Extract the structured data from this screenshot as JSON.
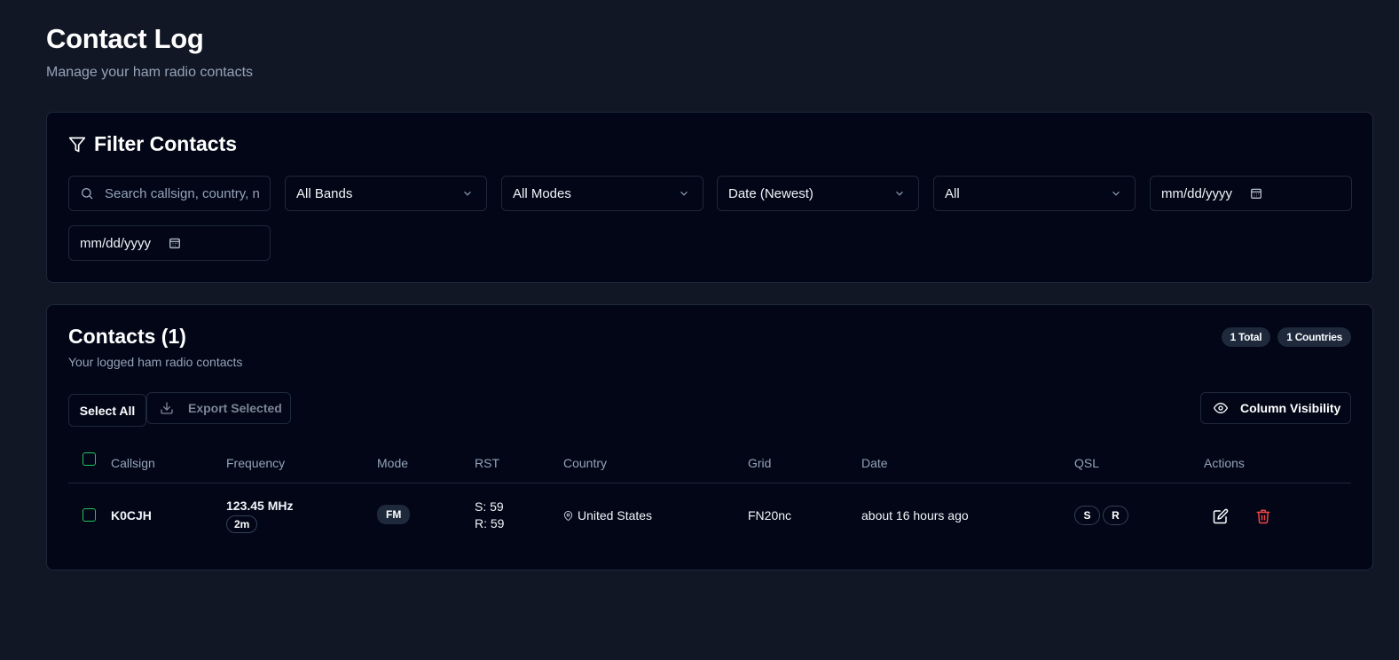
{
  "header": {
    "title": "Contact Log",
    "subtitle": "Manage your ham radio contacts"
  },
  "filters": {
    "title": "Filter Contacts",
    "search_placeholder": "Search callsign, country, n",
    "band": "All Bands",
    "mode": "All Modes",
    "sort": "Date (Newest)",
    "qsl": "All",
    "date_from": "mm/dd/yyyy",
    "date_to": "mm/dd/yyyy"
  },
  "contacts": {
    "title": "Contacts (1)",
    "subtitle": "Your logged ham radio contacts",
    "badge_total": "1 Total",
    "badge_countries": "1 Countries",
    "select_all": "Select All",
    "export_selected": "Export Selected",
    "column_visibility": "Column Visibility",
    "columns": [
      "Callsign",
      "Frequency",
      "Mode",
      "RST",
      "Country",
      "Grid",
      "Date",
      "QSL",
      "Actions"
    ],
    "rows": [
      {
        "callsign": "K0CJH",
        "frequency": "123.45 MHz",
        "band": "2m",
        "mode": "FM",
        "rst_sent": "S: 59",
        "rst_received": "R: 59",
        "country": "United States",
        "grid": "FN20nc",
        "date": "about 16 hours ago",
        "qsl_sent": "S",
        "qsl_received": "R"
      }
    ]
  },
  "icons": {
    "filter": "filter-icon",
    "search": "search-icon",
    "chevron": "chevron-down-icon",
    "calendar": "calendar-icon",
    "download": "download-icon",
    "eye": "eye-icon",
    "location": "map-pin-icon",
    "edit": "edit-icon",
    "delete": "trash-icon"
  },
  "colors": {
    "background": "#121725",
    "card": "#020617",
    "border": "#1e293b",
    "checkbox_accent": "#22c55e",
    "delete": "#ef4444"
  }
}
